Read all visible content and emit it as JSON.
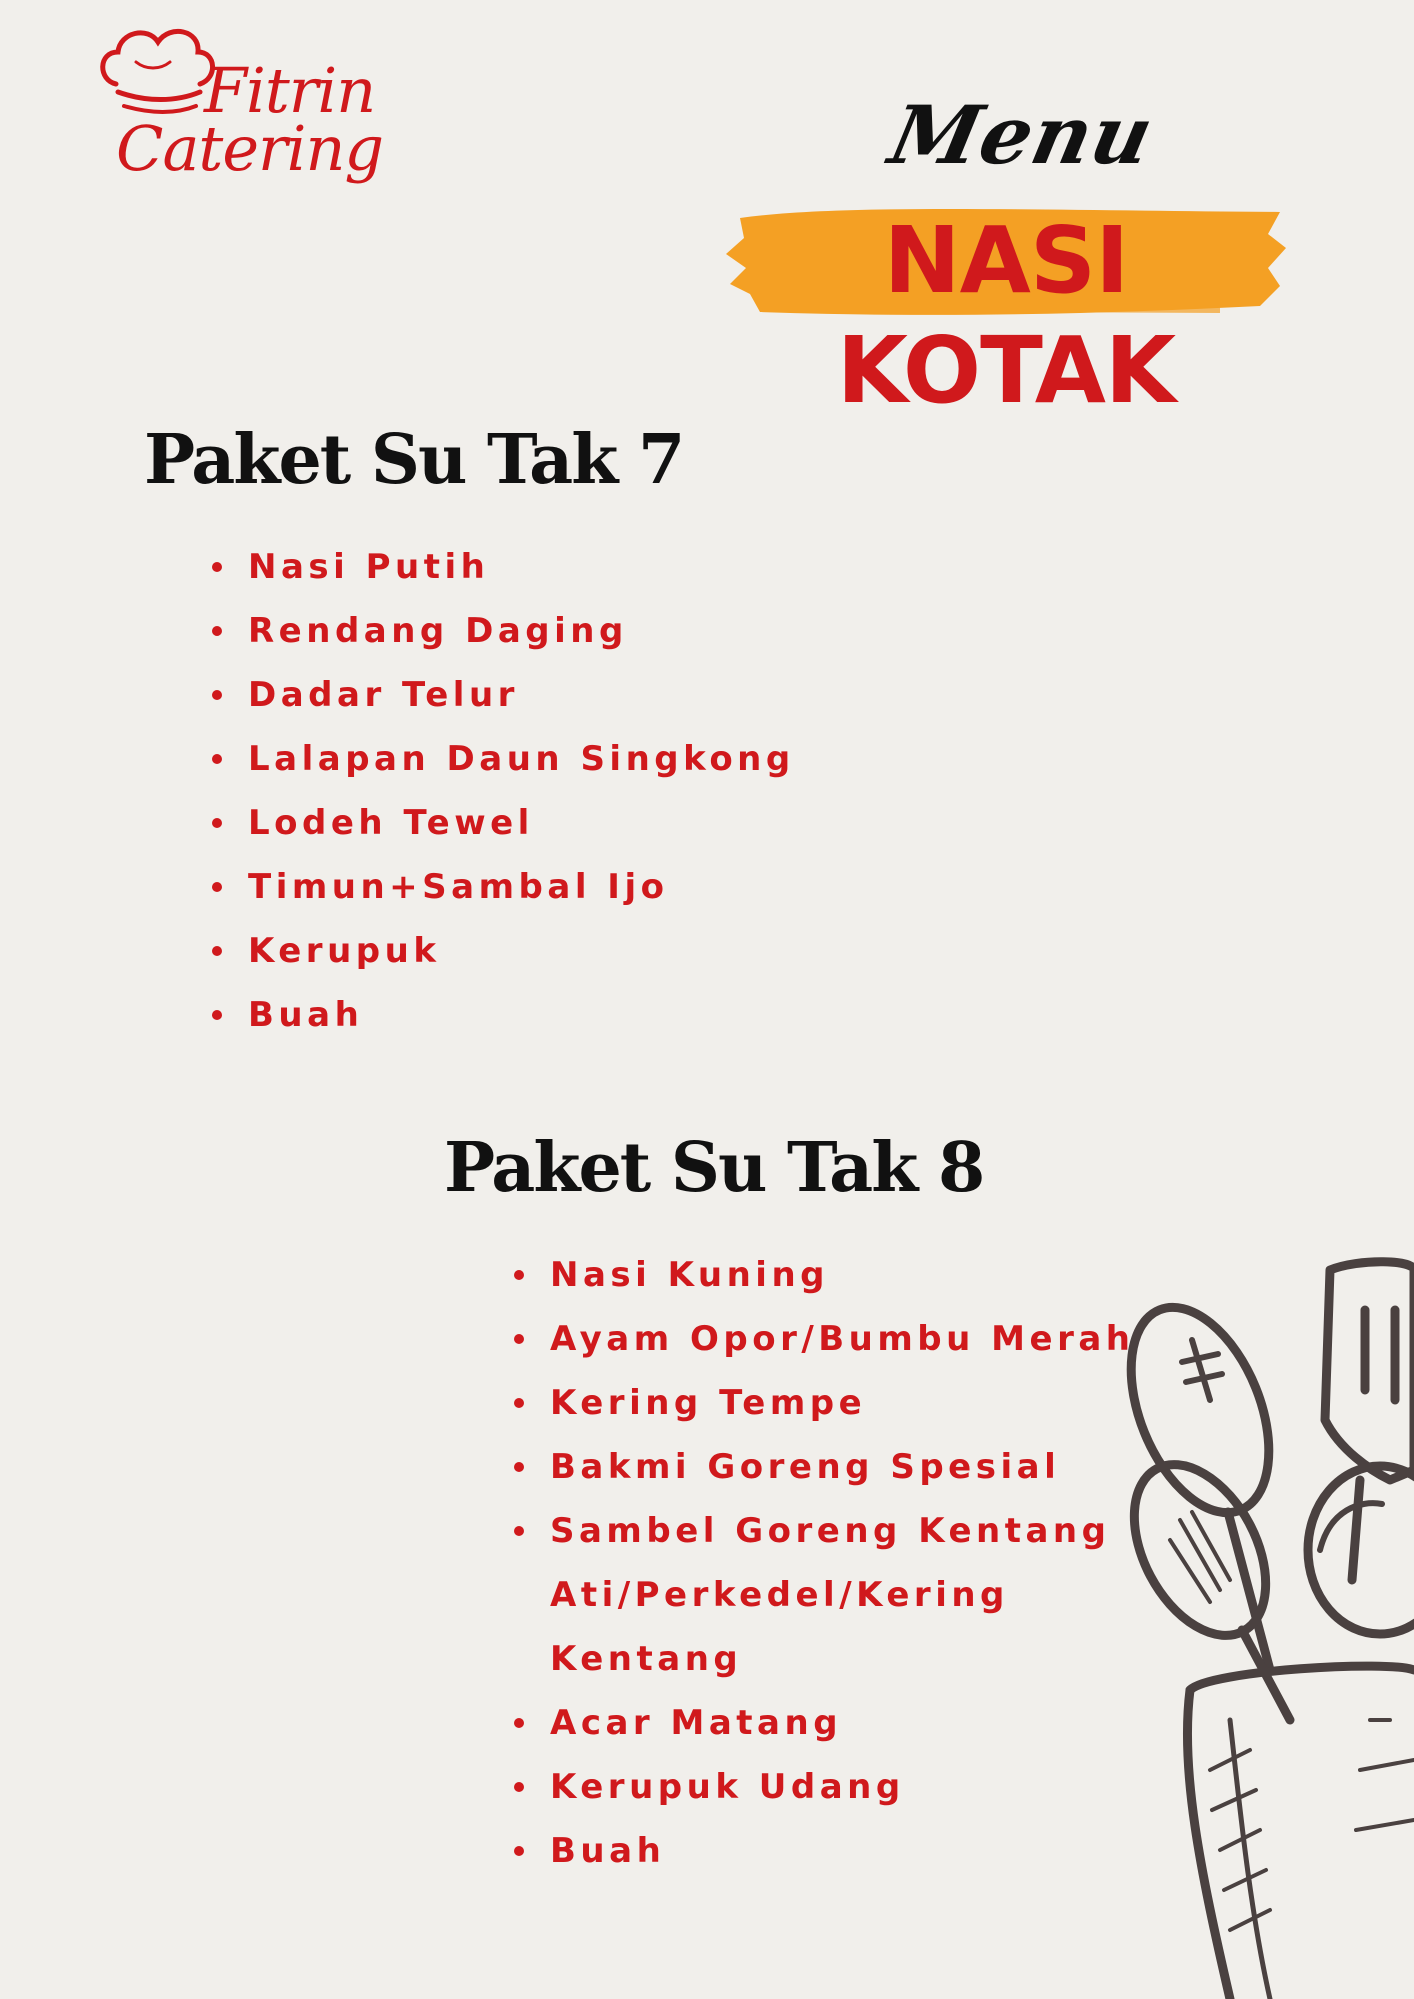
{
  "brand": {
    "line1": "Fitrin",
    "line2": "Catering",
    "color": "#d0191c",
    "icon": "chef-hat-icon"
  },
  "header": {
    "script_word": "Menu",
    "title": "NASI KOTAK",
    "brush_color": "#f4a024"
  },
  "packages": [
    {
      "name": "Paket Su Tak 7",
      "items": [
        "Nasi Putih",
        "Rendang Daging",
        "Dadar Telur",
        "Lalapan Daun Singkong",
        "Lodeh Tewel",
        "Timun+Sambal Ijo",
        "Kerupuk",
        "Buah"
      ]
    },
    {
      "name": "Paket Su Tak 8",
      "items": [
        "Nasi Kuning",
        "Ayam Opor/Bumbu Merah",
        "Kering Tempe",
        "Bakmi Goreng Spesial",
        "Sambel Goreng Kentang",
        "Ati/Perkedel/Kering",
        "Kentang",
        "Acar Matang",
        "Kerupuk Udang",
        "Buah"
      ]
    }
  ],
  "decoration": {
    "icon": "kitchen-utensils-icon"
  }
}
